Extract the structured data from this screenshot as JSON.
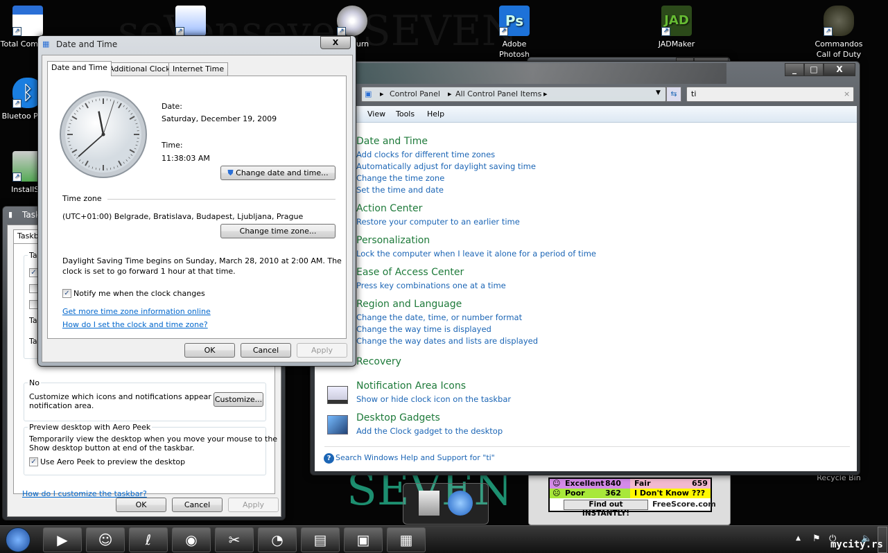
{
  "desktop": {
    "icons": [
      {
        "label": "Total Comman",
        "icon": "floppy-icon"
      },
      {
        "label": "Bluetoo Place",
        "icon": "bluetooth-icon"
      },
      {
        "label": "InstallSir",
        "icon": "installer-icon"
      },
      {
        "label": "",
        "icon": "word-doc-icon"
      },
      {
        "label": "urn",
        "icon": "burn-disc-icon"
      },
      {
        "label": "Adobe Photosh",
        "icon": "photoshop-icon"
      },
      {
        "label": "JADMaker",
        "icon": "jadmaker-icon"
      },
      {
        "label": "Commandos Call of Duty",
        "icon": "grenade-icon"
      },
      {
        "label": "Recycle Bin",
        "icon": "recycle-bin-icon"
      }
    ],
    "watermark": "seVenseven SEVEN"
  },
  "datetime_dialog": {
    "title": "Date and Time",
    "tabs": [
      "Date and Time",
      "Additional Clocks",
      "Internet Time"
    ],
    "active_tab": 0,
    "date_label": "Date:",
    "date_value": "Saturday, December 19, 2009",
    "time_label": "Time:",
    "time_value": "11:38:03 AM",
    "clock": {
      "hour": 11,
      "minute": 38,
      "second": 3
    },
    "change_datetime_button": "Change date and time...",
    "timezone_label": "Time zone",
    "timezone_value": "(UTC+01:00) Belgrade, Bratislava, Budapest, Ljubljana, Prague",
    "change_timezone_button": "Change time zone...",
    "dst_text_1": "Daylight Saving Time begins on Sunday, March 28, 2010 at 2:00 AM. The",
    "dst_text_2": "clock is set to go forward 1 hour at that time.",
    "notify_label": "Notify me when the clock changes",
    "notify_checked": true,
    "link_1": "Get more time zone information online",
    "link_2": "How do I set the clock and time zone?",
    "ok": "OK",
    "cancel": "Cancel",
    "apply": "Apply",
    "close": "X"
  },
  "taskbar_dialog": {
    "title": "Task",
    "tab": "Taskb",
    "group1_title": "Ta",
    "row_label_1": "Ta",
    "row_label_2": "Ta",
    "checks": [
      true,
      false,
      false
    ],
    "notif_title": "No",
    "notif_text_1": "Customize which icons and notifications appear in the",
    "notif_text_2": "notification area.",
    "customize_button": "Customize...",
    "peek_title": "Preview desktop with Aero Peek",
    "peek_text_1": "Temporarily view the desktop when you move your mouse to the",
    "peek_text_2": "Show desktop button at end of the taskbar.",
    "peek_check_label": "Use Aero Peek to preview the desktop",
    "peek_checked": true,
    "help_link": "How do I customize the taskbar?",
    "ok": "OK",
    "cancel": "Cancel",
    "apply": "Apply"
  },
  "control_panel": {
    "breadcrumb": [
      "Control Panel",
      "All Control Panel Items"
    ],
    "search_value": "ti",
    "menu": [
      "View",
      "Tools",
      "Help"
    ],
    "results": [
      {
        "title": "Date and Time",
        "links": [
          "Add clocks for different time zones",
          "Automatically adjust for daylight saving time",
          "Change the time zone",
          "Set the time and date"
        ]
      },
      {
        "title": "Action Center",
        "links": [
          "Restore your computer to an earlier time"
        ]
      },
      {
        "title": "Personalization",
        "links": [
          "Lock the computer when I leave it alone for a period of time"
        ]
      },
      {
        "title": "Ease of Access Center",
        "links": [
          "Press key combinations one at a time"
        ]
      },
      {
        "title": "Region and Language",
        "links": [
          "Change the date, time, or number format",
          "Change the way time is displayed",
          "Change the way dates and lists are displayed"
        ]
      },
      {
        "title": "Recovery",
        "links": []
      },
      {
        "title": "Notification Area Icons",
        "links": [
          "Show or hide clock icon on the taskbar"
        ]
      },
      {
        "title": "Desktop Gadgets",
        "links": [
          "Add the Clock gadget to the desktop"
        ]
      }
    ],
    "help_search": "Search Windows Help and Support for \"ti\""
  },
  "freescore": {
    "rows": [
      {
        "a_label": "Excellent",
        "a_value": "840",
        "b_label": "Fair",
        "b_value": "659"
      },
      {
        "a_label": "Poor",
        "a_value": "362",
        "b_label": "I Don't Know",
        "b_value": "???"
      }
    ],
    "cta": "Find out INSTANTLY!",
    "brand": "FreeScore.com"
  },
  "taskbar": {
    "apps": [
      "media-player-icon",
      "messenger-icon",
      "corel-icon",
      "firefox-icon",
      "paint-icon",
      "clock-gadget-icon",
      "server-manager-icon",
      "control-panel-icon",
      "date-time-icon"
    ],
    "watermark": "mycity.rs"
  }
}
